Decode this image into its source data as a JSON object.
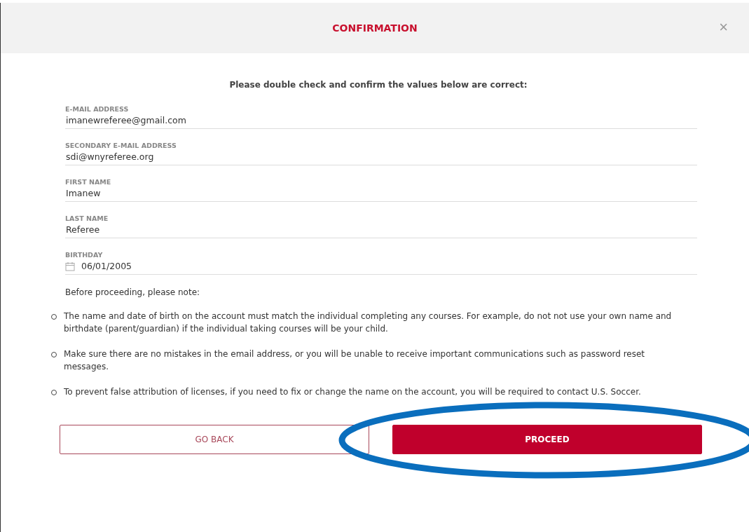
{
  "dialog": {
    "title": "CONFIRMATION",
    "close": "×"
  },
  "intro": "Please double check and confirm the values below are correct:",
  "fields": [
    {
      "label": "E-MAIL ADDRESS",
      "value": "imanewreferee@gmail.com",
      "kind": "text"
    },
    {
      "label": "SECONDARY E-MAIL ADDRESS",
      "value": "sdi@wnyreferee.org",
      "kind": "text"
    },
    {
      "label": "FIRST NAME",
      "value": "Imanew",
      "kind": "text"
    },
    {
      "label": "LAST NAME",
      "value": "Referee",
      "kind": "text"
    },
    {
      "label": "BIRTHDAY",
      "value": "06/01/2005",
      "kind": "date"
    }
  ],
  "notes_heading": "Before proceeding, please note:",
  "notes": [
    "The name and date of birth on the account must match the individual completing any courses. For example, do not not use your own name and birthdate (parent/guardian) if the individual taking courses will be your child.",
    "Make sure there are no mistakes in the email address, or you will be unable to receive important communications such as password reset messages.",
    "To prevent false attribution of licenses, if you need to fix or change the name on the account, you will be required to contact U.S. Soccer."
  ],
  "buttons": [
    {
      "label": "GO BACK",
      "kind": "secondary"
    },
    {
      "label": "PROCEED",
      "kind": "primary",
      "highlighted": true
    }
  ]
}
